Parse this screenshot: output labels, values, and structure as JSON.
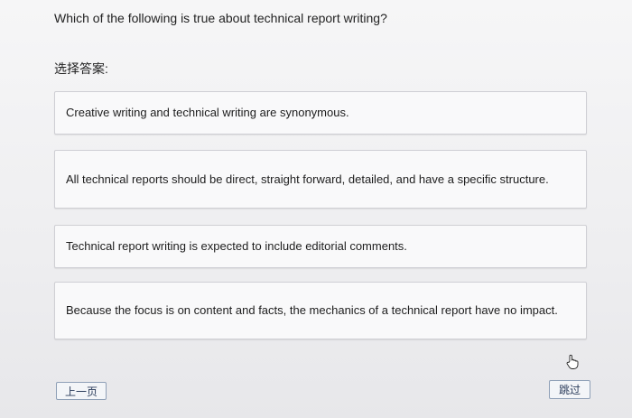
{
  "question": {
    "text": "Which of the following is true about technical report writing?"
  },
  "select_label": "选择答案:",
  "options": [
    {
      "text": "Creative writing and technical writing are synonymous."
    },
    {
      "text": "All technical reports should be direct, straight forward, detailed, and have a specific structure."
    },
    {
      "text": "Technical report writing is expected to include editorial comments."
    },
    {
      "text": "Because the focus is on content and facts, the mechanics of a technical report have no impact."
    }
  ],
  "buttons": {
    "prev_label": "上一页",
    "skip_label": "跳过"
  },
  "icons": {
    "cursor": "hand-pointer-icon"
  },
  "colors": {
    "button_border": "#8fa0b7",
    "option_border": "#cfcfd4"
  }
}
